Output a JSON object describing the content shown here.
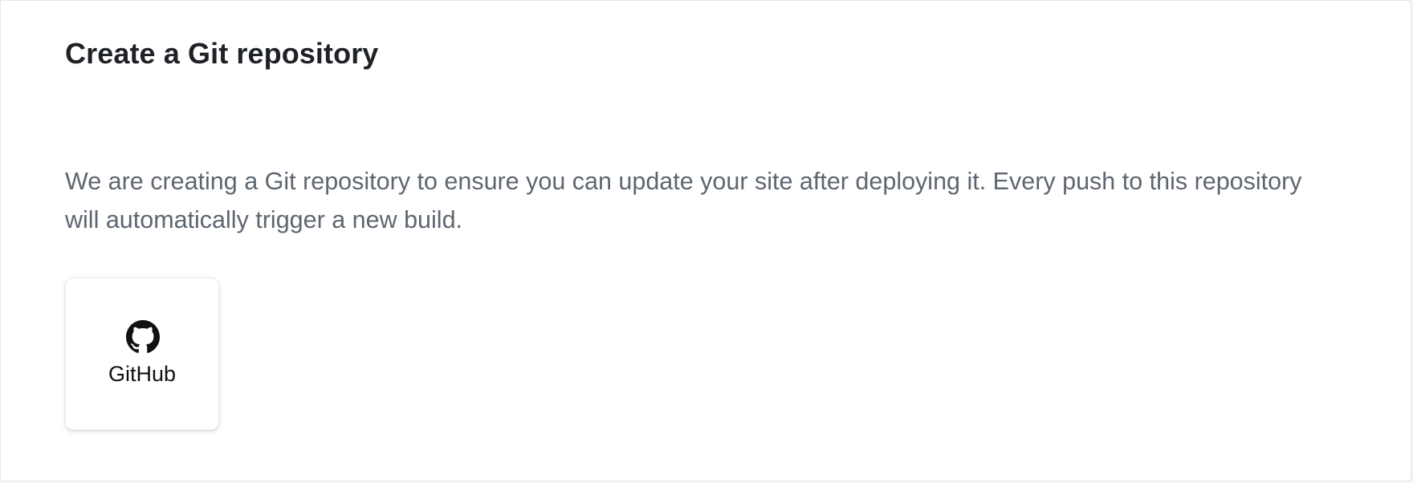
{
  "section": {
    "title": "Create a Git repository",
    "description": "We are creating a Git repository to ensure you can update your site after deploying it. Every push to this repository will automatically trigger a new build."
  },
  "providers": [
    {
      "label": "GitHub",
      "icon": "github-icon"
    }
  ],
  "colors": {
    "title": "#1e2125",
    "description": "#5e6670",
    "card_border": "#e3e5e8",
    "tile_border": "#eceef0",
    "icon": "#111111"
  }
}
